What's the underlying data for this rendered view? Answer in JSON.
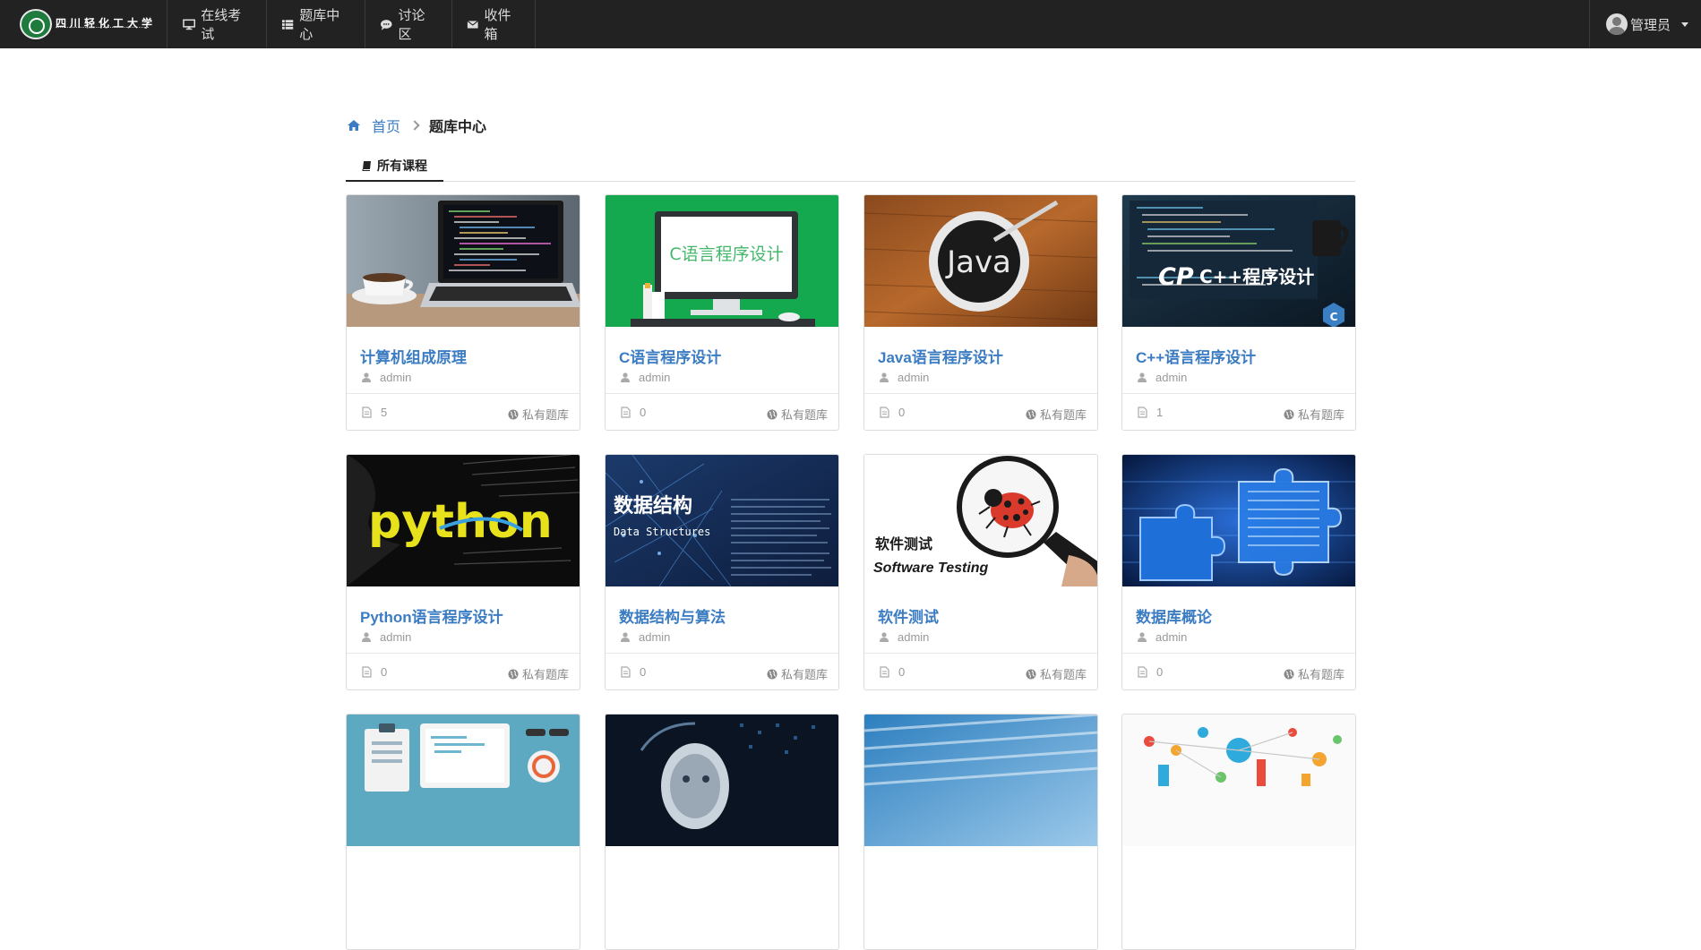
{
  "navbar": {
    "brand_text": "四川轻化工大学",
    "items": [
      {
        "label": "在线考试",
        "icon": "desktop-icon"
      },
      {
        "label": "题库中心",
        "icon": "list-icon"
      },
      {
        "label": "讨论区",
        "icon": "comment-icon"
      },
      {
        "label": "收件箱",
        "icon": "envelope-icon"
      }
    ],
    "user": {
      "name": "管理员"
    }
  },
  "breadcrumb": {
    "home": "首页",
    "current": "题库中心"
  },
  "tabs": [
    {
      "label": "所有课程",
      "icon": "book-icon"
    }
  ],
  "courses": [
    {
      "title": "计算机组成原理",
      "author": "admin",
      "count": "5",
      "visibility": "私有题库"
    },
    {
      "title": "C语言程序设计",
      "author": "admin",
      "count": "0",
      "visibility": "私有题库",
      "cover_text": "C语言程序设计"
    },
    {
      "title": "Java语言程序设计",
      "author": "admin",
      "count": "0",
      "visibility": "私有题库",
      "cover_text": "Java"
    },
    {
      "title": "C++语言程序设计",
      "author": "admin",
      "count": "1",
      "visibility": "私有题库",
      "cover_text": "C++程序设计"
    },
    {
      "title": "Python语言程序设计",
      "author": "admin",
      "count": "0",
      "visibility": "私有题库",
      "cover_text": "python"
    },
    {
      "title": "数据结构与算法",
      "author": "admin",
      "count": "0",
      "visibility": "私有题库",
      "cover_text": "数据结构",
      "cover_subtext": "Data Structures"
    },
    {
      "title": "软件测试",
      "author": "admin",
      "count": "0",
      "visibility": "私有题库",
      "cover_text": "软件测试",
      "cover_subtext": "Software Testing"
    },
    {
      "title": "数据库概论",
      "author": "admin",
      "count": "0",
      "visibility": "私有题库"
    },
    {
      "title": "",
      "author": "",
      "count": "",
      "visibility": ""
    },
    {
      "title": "",
      "author": "",
      "count": "",
      "visibility": ""
    },
    {
      "title": "",
      "author": "",
      "count": "",
      "visibility": ""
    },
    {
      "title": "",
      "author": "",
      "count": "",
      "visibility": ""
    }
  ],
  "colors": {
    "navbar": "#222222",
    "link": "#3b7cc2",
    "muted": "#999999"
  }
}
